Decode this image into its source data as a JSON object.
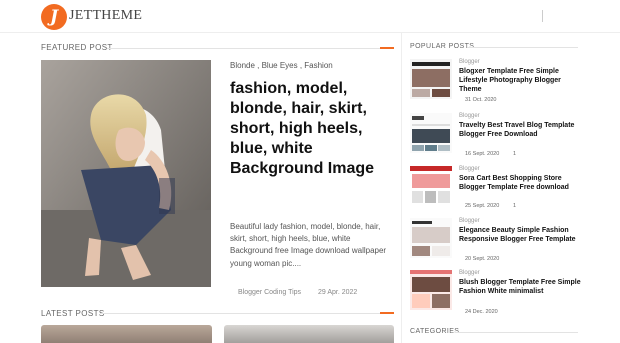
{
  "header": {
    "logo_letter": "J",
    "logo_text": "JETTHEME"
  },
  "featured": {
    "heading": "FEATURED POST",
    "tags": "Blonde , Blue Eyes , Fashion",
    "title": "fashion, model, blonde, hair, skirt, short, high heels, blue, white Background Image",
    "excerpt": "Beautiful lady fashion, model, blonde, hair, skirt, short, high heels, blue, white Background free Image download wallpaper young woman pic....",
    "author": "Blogger Coding Tips",
    "date": "29 Apr. 2022"
  },
  "latest": {
    "heading": "LATEST POSTS"
  },
  "sidebar": {
    "popular_heading": "POPULAR POSTS",
    "categories_heading": "CATEGORIES",
    "items": [
      {
        "category": "Blogger",
        "title": "Blogxer Template Free Simple Lifestyle Photography Blogger Theme",
        "date": "31 Oct. 2020",
        "count": ""
      },
      {
        "category": "Blogger",
        "title": "Travelty Best Travel Blog Template Blogger Free Download",
        "date": "16 Sept. 2020",
        "count": "1"
      },
      {
        "category": "Blogger",
        "title": "Sora Cart Best Shopping Store Blogger Template Free download",
        "date": "25 Sept. 2020",
        "count": "1"
      },
      {
        "category": "Blogger",
        "title": "Elegance Beauty Simple Fashion Responsive Blogger Free Template",
        "date": "20 Sept. 2020",
        "count": ""
      },
      {
        "category": "Blogger",
        "title": "Blush Blogger Template Free Simple Fashion White minimalist",
        "date": "24 Dec. 2020",
        "count": ""
      }
    ]
  },
  "colors": {
    "accent": "#f26b21",
    "text": "#111111",
    "muted": "#888888"
  },
  "icons": {
    "logo": "jettheme-logo-icon"
  }
}
